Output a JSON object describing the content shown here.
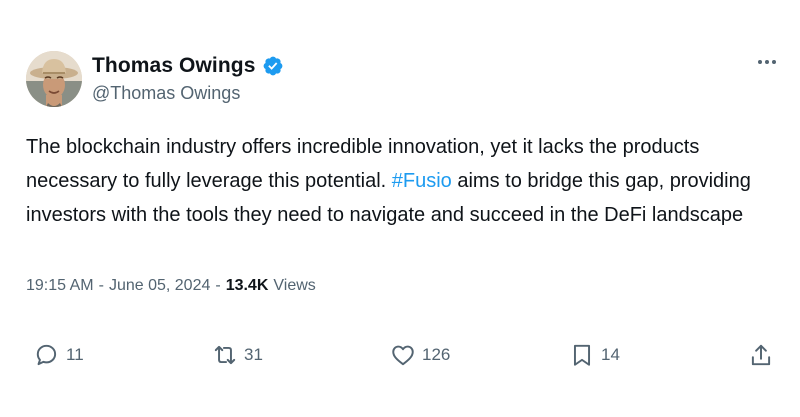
{
  "author": {
    "name": "Thomas Owings",
    "handle": "@Thomas Owings",
    "verified": true,
    "verified_color": "#1d9bf0"
  },
  "tweet": {
    "text_before": "The blockchain industry offers incredible innovation, yet it lacks the products necessary to fully leverage this potential. ",
    "hashtag": "#Fusio",
    "text_after": " aims to bridge this gap, providing investors with the tools they need to navigate and succeed in the DeFi landscape"
  },
  "meta": {
    "time": "19:15 AM",
    "separator": "-",
    "date": "June 05, 2024",
    "views_count": "13.4K",
    "views_label": "Views"
  },
  "actions": {
    "replies": "11",
    "reposts": "31",
    "likes": "126",
    "bookmarks": "14"
  },
  "icons": [
    "more-icon",
    "verified-badge-icon",
    "reply-icon",
    "repost-icon",
    "like-icon",
    "bookmark-icon",
    "share-icon"
  ],
  "colors": {
    "accent": "#1d9bf0",
    "text": "#0f1419",
    "muted": "#536471"
  }
}
